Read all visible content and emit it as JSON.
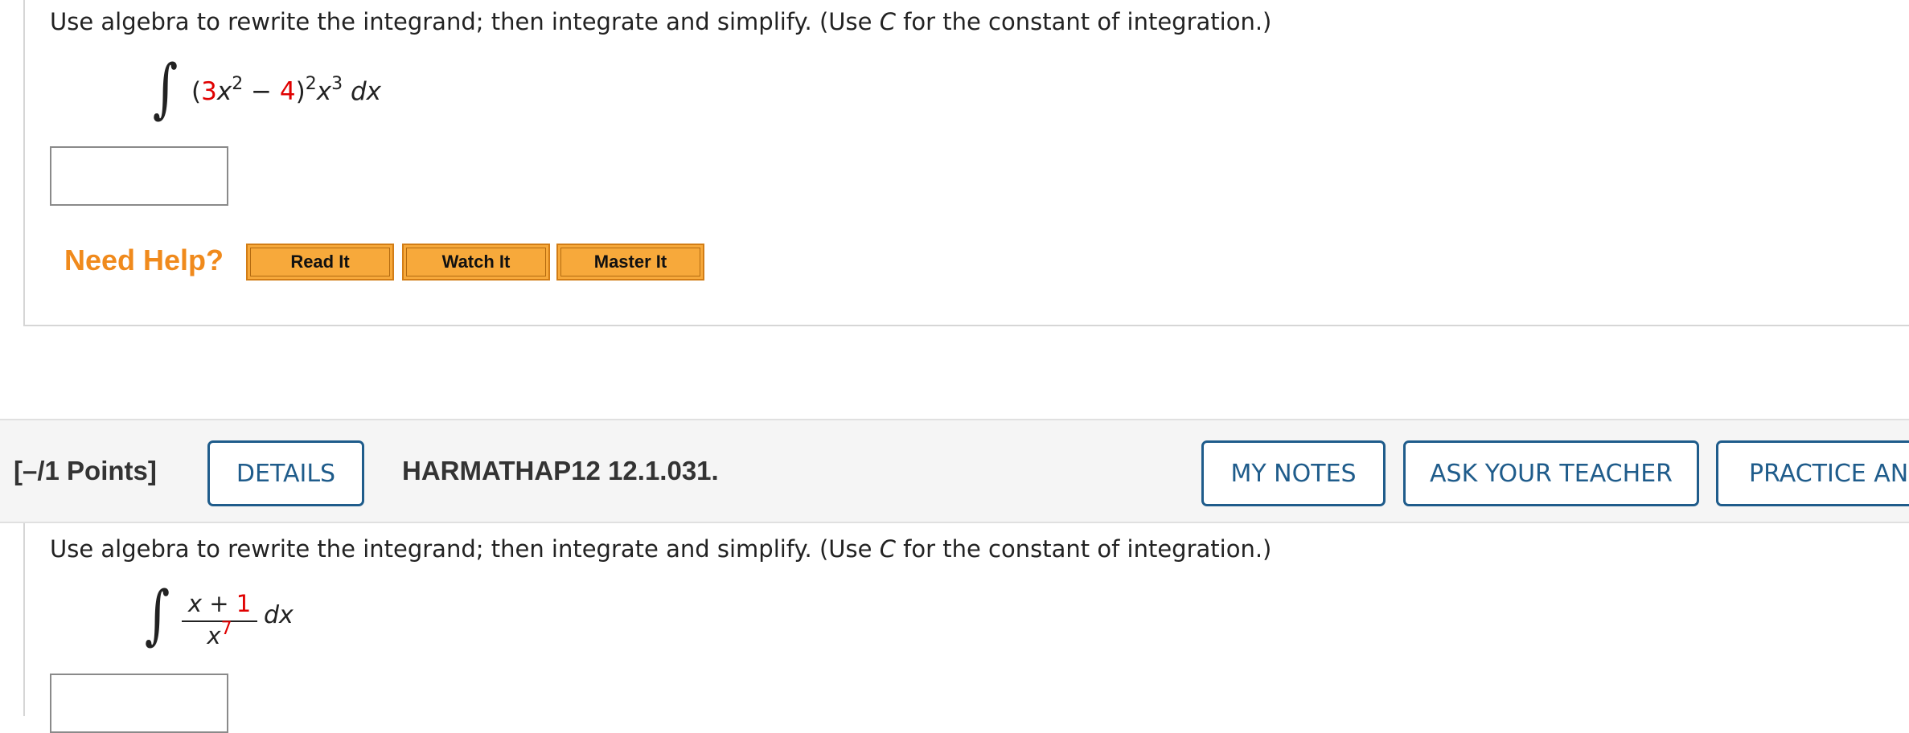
{
  "question1": {
    "prompt_before": "Use algebra to rewrite the integrand; then integrate and simplify. (Use ",
    "prompt_var": "C",
    "prompt_after": " for the constant of integration.)",
    "integral_symbol": "∫",
    "expr": {
      "open": "(",
      "coef": "3",
      "x1": "x",
      "exp1": "2",
      "minus": " − ",
      "const": "4",
      "close": ")",
      "exp2": "2",
      "x2": "x",
      "exp3": "3",
      "dx": " dx"
    },
    "answer_value": ""
  },
  "help": {
    "label": "Need Help?",
    "buttons": [
      "Read It",
      "Watch It",
      "Master It"
    ]
  },
  "question2_header": {
    "points": "[–/1 Points]",
    "details_label": "DETAILS",
    "question_id": "HARMATHAP12 12.1.031.",
    "my_notes_label": "MY NOTES",
    "ask_teacher_label": "ASK YOUR TEACHER",
    "practice_label": "PRACTICE ANOTHER"
  },
  "question2": {
    "prompt_before": "Use algebra to rewrite the integrand; then integrate and simplify. (Use ",
    "prompt_var": "C",
    "prompt_after": " for the constant of integration.)",
    "integral_symbol": "∫",
    "numerator_x": "x",
    "numerator_plus": " + ",
    "numerator_const": "1",
    "denominator_x": "x",
    "denominator_exp": "7",
    "dx": "dx",
    "answer_value": ""
  },
  "colors": {
    "accent_blue": "#1f5c8b",
    "help_orange": "#f08a1c",
    "button_orange": "#f7a93b",
    "highlight_red": "#e00000"
  }
}
